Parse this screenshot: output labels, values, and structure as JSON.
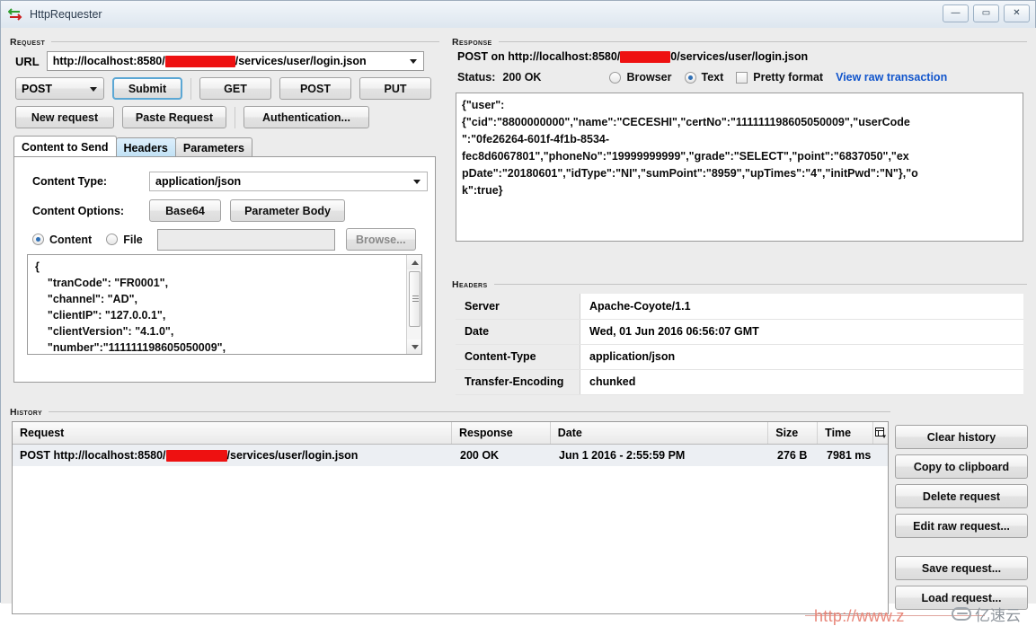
{
  "window": {
    "title": "HttpRequester",
    "icon": "arrows-icon",
    "controls": [
      {
        "name": "minimize-button",
        "glyph": "—"
      },
      {
        "name": "maximize-button",
        "glyph": "▭"
      },
      {
        "name": "close-button",
        "glyph": "✕"
      }
    ]
  },
  "request": {
    "section_title": "Request",
    "url_label": "URL",
    "url_prefix": "http://localhost:8580/",
    "url_suffix": "/services/user/login.json",
    "url_redacted": true,
    "method_selected": "POST",
    "submit_label": "Submit",
    "quick_methods": [
      "GET",
      "POST",
      "PUT"
    ],
    "new_request_label": "New request",
    "paste_request_label": "Paste Request",
    "authentication_label": "Authentication...",
    "tabs": [
      {
        "label": "Content to Send",
        "state": "active"
      },
      {
        "label": "Headers",
        "state": "hover"
      },
      {
        "label": "Parameters",
        "state": "normal"
      }
    ],
    "content_type_label": "Content Type:",
    "content_type_value": "application/json",
    "content_options_label": "Content Options:",
    "base64_label": "Base64",
    "parameter_body_label": "Parameter Body",
    "source_content_label": "Content",
    "source_file_label": "File",
    "source_selected": "Content",
    "file_path_value": "",
    "browse_label": "Browse...",
    "body_text": "{\n    \"tranCode\": \"FR0001\",\n    \"channel\": \"AD\",\n    \"clientIP\": \"127.0.0.1\",\n    \"clientVersion\": \"4.1.0\",\n    \"number\":\"111111198605050009\","
  },
  "response": {
    "section_title": "Response",
    "request_line_prefix": "POST on http://localhost:8580/",
    "request_line_suffix": "0/services/user/login.json",
    "status_label": "Status:",
    "status_value": "200 OK",
    "view_browser_label": "Browser",
    "view_text_label": "Text",
    "view_selected": "Text",
    "pretty_format_label": "Pretty format",
    "pretty_format_checked": false,
    "view_raw_label": "View raw transaction",
    "link_color": "#1155cc",
    "body_text": "{\"user\":\n{\"cid\":\"8800000000\",\"name\":\"CECESHI\",\"certNo\":\"111111198605050009\",\"userCode\n\":\"0fe26264-601f-4f1b-8534-\nfec8d6067801\",\"phoneNo\":\"19999999999\",\"grade\":\"SELECT\",\"point\":\"6837050\",\"ex\npDate\":\"20180601\",\"idType\":\"NI\",\"sumPoint\":\"8959\",\"upTimes\":\"4\",\"initPwd\":\"N\"},\"o\nk\":true}"
  },
  "headers": {
    "section_title": "Headers",
    "rows": [
      {
        "key": "Server",
        "value": "Apache-Coyote/1.1"
      },
      {
        "key": "Date",
        "value": "Wed, 01 Jun 2016 06:56:07 GMT"
      },
      {
        "key": "Content-Type",
        "value": "application/json"
      },
      {
        "key": "Transfer-Encoding",
        "value": "chunked"
      }
    ]
  },
  "history": {
    "section_title": "History",
    "columns": [
      "Request",
      "Response",
      "Date",
      "Size",
      "Time"
    ],
    "settings_icon": "column-settings-icon",
    "rows": [
      {
        "request_prefix": "POST http://localhost:8580/",
        "request_suffix": "/services/user/login.json",
        "response": "200 OK",
        "date": "Jun 1 2016 - 2:55:59 PM",
        "size": "276 B",
        "time": "7981 ms"
      }
    ],
    "buttons": [
      "Clear history",
      "Copy to clipboard",
      "Delete request",
      "Edit raw request...",
      "Save request...",
      "Load request..."
    ]
  },
  "watermark": {
    "url_text": "http://www.z",
    "logo_text": "亿速云"
  },
  "colors": {
    "redaction": "#ee1111",
    "link": "#1155cc",
    "tab_hover": "#bfe0f4",
    "focus_border": "#5ba7d4"
  }
}
